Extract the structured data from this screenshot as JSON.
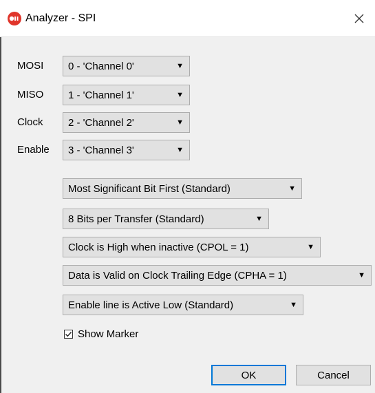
{
  "window": {
    "title": "Analyzer - SPI",
    "icons": {
      "app": "saleae-logo-icon",
      "close": "close-icon"
    }
  },
  "channels": [
    {
      "label": "MOSI",
      "value": "0 - 'Channel 0'"
    },
    {
      "label": "MISO",
      "value": "1 - 'Channel 1'"
    },
    {
      "label": "Clock",
      "value": "2 - 'Channel 2'"
    },
    {
      "label": "Enable",
      "value": "3 - 'Channel 3'"
    }
  ],
  "settings": [
    "Most Significant Bit First (Standard)",
    "8 Bits per Transfer (Standard)",
    "Clock is High when inactive (CPOL = 1)",
    "Data is Valid on Clock Trailing Edge (CPHA = 1)",
    "Enable line is Active Low (Standard)"
  ],
  "show_marker": {
    "label": "Show Marker",
    "checked": true
  },
  "buttons": {
    "ok": "OK",
    "cancel": "Cancel"
  },
  "colors": {
    "accent": "#0078d7",
    "logo": "#e0352b"
  }
}
